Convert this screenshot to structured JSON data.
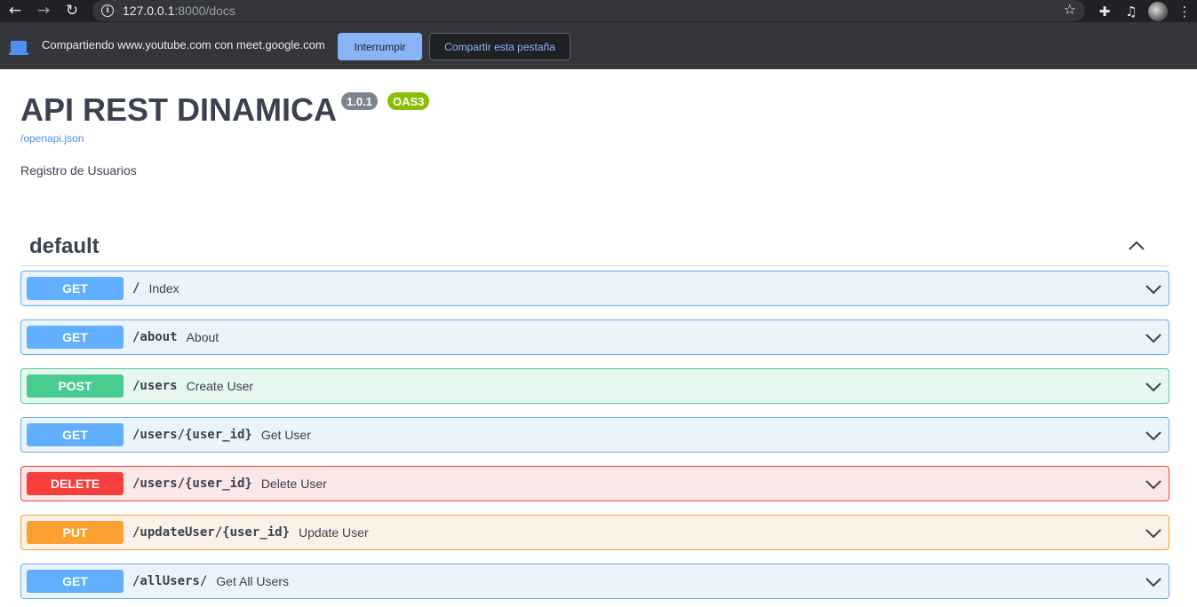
{
  "browser": {
    "url_host": "127.0.0.1",
    "url_rest": ":8000/docs"
  },
  "share_bar": {
    "message": "Compartiendo www.youtube.com con meet.google.com",
    "stop_label": "Interrumpir",
    "share_tab_label": "Compartir esta pestaña"
  },
  "api": {
    "title": "API REST DINAMICA",
    "version": "1.0.1",
    "oas": "OAS3",
    "spec_link": "/openapi.json",
    "description": "Registro de Usuarios"
  },
  "tag": {
    "name": "default"
  },
  "operations": [
    {
      "method": "GET",
      "path": "/",
      "summary": "Index"
    },
    {
      "method": "GET",
      "path": "/about",
      "summary": "About"
    },
    {
      "method": "POST",
      "path": "/users",
      "summary": "Create User"
    },
    {
      "method": "GET",
      "path": "/users/{user_id}",
      "summary": "Get User"
    },
    {
      "method": "DELETE",
      "path": "/users/{user_id}",
      "summary": "Delete User"
    },
    {
      "method": "PUT",
      "path": "/updateUser/{user_id}",
      "summary": "Update User"
    },
    {
      "method": "GET",
      "path": "/allUsers/",
      "summary": "Get All Users"
    }
  ],
  "colors": {
    "get": "#61affe",
    "post": "#49cc90",
    "delete": "#f93e3e",
    "put": "#fca130"
  }
}
